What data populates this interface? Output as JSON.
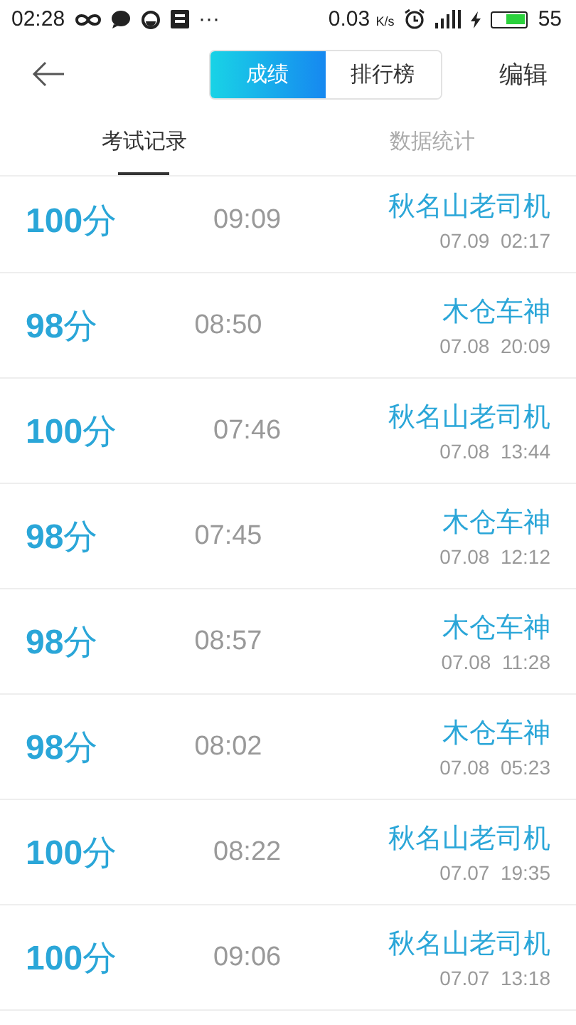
{
  "status_bar": {
    "time": "02:28",
    "dots": "···",
    "speed": "0.03",
    "speed_unit": "K/s",
    "battery": "55"
  },
  "header": {
    "segments": [
      {
        "label": "成绩",
        "selected": true
      },
      {
        "label": "排行榜",
        "selected": false
      }
    ],
    "action": "编辑"
  },
  "tabs": [
    {
      "label": "考试记录",
      "selected": true
    },
    {
      "label": "数据统计",
      "selected": false
    }
  ],
  "records": [
    {
      "score": "**100**分",
      "duration": "09:09",
      "name": "秋名山老司机",
      "date": "07.09  02:17"
    },
    {
      "score": "**98**分",
      "duration": "08:50",
      "name": "木仓车神",
      "date": "07.08  20:09"
    },
    {
      "score": "**100**分",
      "duration": "07:46",
      "name": "秋名山老司机",
      "date": "07.08  13:44"
    },
    {
      "score": "**98**分",
      "duration": "07:45",
      "name": "木仓车神",
      "date": "07.08  12:12"
    },
    {
      "score": "**98**分",
      "duration": "08:57",
      "name": "木仓车神",
      "date": "07.08  11:28"
    },
    {
      "score": "**98**分",
      "duration": "08:02",
      "name": "木仓车神",
      "date": "07.08  05:23"
    },
    {
      "score": "**100**分",
      "duration": "08:22",
      "name": "秋名山老司机",
      "date": "07.07  19:35"
    },
    {
      "score": "**100**分",
      "duration": "09:06",
      "name": "秋名山老司机",
      "date": "07.07  13:18"
    }
  ]
}
